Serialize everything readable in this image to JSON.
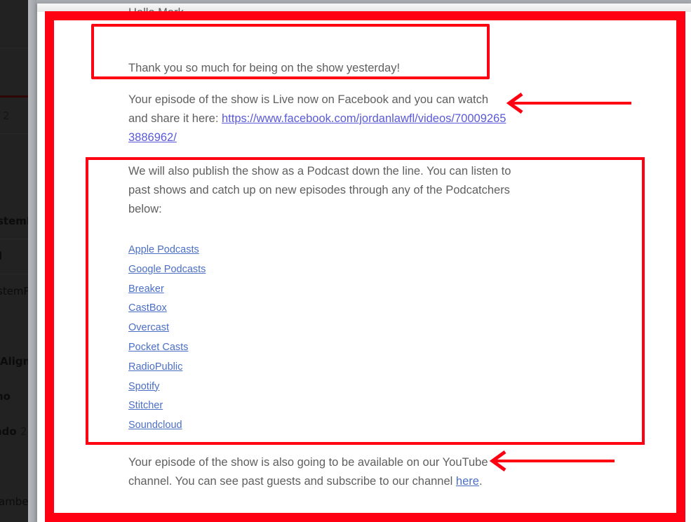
{
  "sidebar": {
    "items": [
      {
        "label": "2",
        "style": "count"
      },
      {
        "label": "stemI",
        "style": "bold"
      },
      {
        "label": "l",
        "style": "bold"
      },
      {
        "label": "stemP",
        "style": "normal"
      },
      {
        "label": "Align",
        "style": "bold"
      },
      {
        "label": "no",
        "style": "bold"
      },
      {
        "label": "ndo",
        "style": "bold",
        "count": "2"
      },
      {
        "label": "ambe",
        "style": "normal"
      }
    ]
  },
  "email": {
    "greeting": "Hello Mark,",
    "thanks": "Thank you so much for being on the show yesterday!",
    "facebook_paragraph": {
      "text": "Your episode of the show is Live now on Facebook and you can watch and share it here: ",
      "link_text": "https://www.facebook.com/jordanlawfl/videos/700092653886962/"
    },
    "podcast_paragraph": "We will also publish the show as a Podcast down the line. You can listen to past shows and catch up on new episodes through any of the Podcatchers below:",
    "podcast_links": [
      "Apple Podcasts",
      "Google Podcasts",
      "Breaker",
      "CastBox",
      "Overcast",
      "Pocket Casts",
      "RadioPublic",
      "Spotify",
      "Stitcher",
      "Soundcloud"
    ],
    "youtube_paragraph": {
      "text": "Your episode of the show is also going to be available on our YouTube channel. You can see past guests and subscribe to our channel ",
      "link_text": "here",
      "suffix": "."
    }
  },
  "annotations": {
    "color": "#ff0012",
    "frames": [
      "outer-frame",
      "greeting-frame",
      "podcast-frame"
    ],
    "arrows": [
      "facebook-arrow",
      "youtube-arrow"
    ]
  }
}
